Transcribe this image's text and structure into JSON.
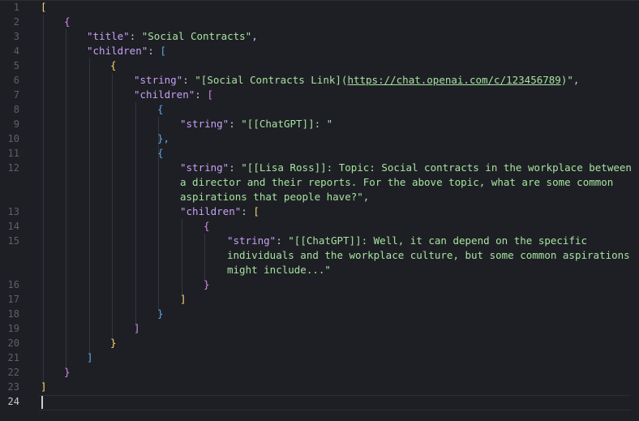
{
  "editor": {
    "line_numbers": [
      "1",
      "2",
      "3",
      "4",
      "5",
      "6",
      "7",
      "8",
      "9",
      "10",
      "11",
      "12",
      "13",
      "14",
      "15",
      "16",
      "17",
      "18",
      "19",
      "20",
      "21",
      "22",
      "23",
      "24"
    ],
    "active_line": "24"
  },
  "code": {
    "l1_open": "[",
    "l2_open": "{",
    "title_key": "\"title\"",
    "title_val": "\"Social Contracts\"",
    "children_key": "\"children\"",
    "l4_open": "[",
    "l5_open": "{",
    "string_key": "\"string\"",
    "l6_pre": "\"[Social Contracts Link](",
    "l6_url": "https://chat.openai.com/c/123456789",
    "l6_post": ")\"",
    "l7_open": "[",
    "l8_open": "{",
    "l9_val": "\"[[ChatGPT]]: \"",
    "l10_close": "},",
    "l11_open": "{",
    "l12_val_1": "\"[[Lisa Ross]]: Topic: Social contracts in the workplace between",
    "l12_val_2": "a director and their reports. For the above topic, what are some common",
    "l12_val_3": "aspirations that people have?\"",
    "l13_open": "[",
    "l14_open": "{",
    "l15_val_1": "\"[[ChatGPT]]: Well, it can depend on the specific",
    "l15_val_2": "individuals and the workplace culture, but some common aspirations",
    "l15_val_3": "might include...\"",
    "l16_close": "}",
    "l17_close": "]",
    "l18_close": "}",
    "l19_close": "]",
    "l20_close": "}",
    "l21_close": "]",
    "l22_close": "}",
    "l23_close": "]"
  }
}
